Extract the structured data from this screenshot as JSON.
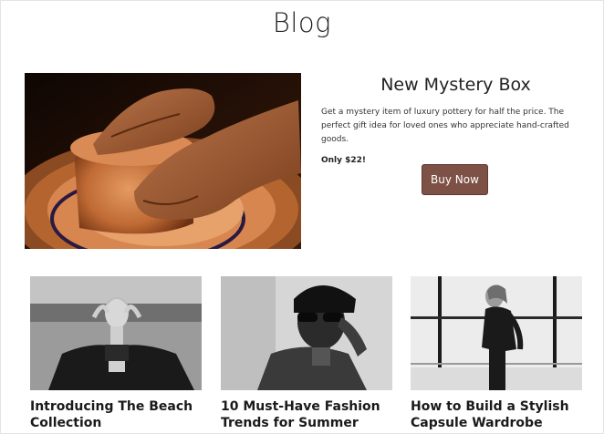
{
  "page": {
    "title": "Blog"
  },
  "promo": {
    "title": "New Mystery Box",
    "description": "Get a mystery item of luxury pottery for half the price. The perfect gift idea for loved ones who appreciate hand-crafted goods.",
    "price": "Only $22!",
    "button_label": "Buy Now",
    "image": "pottery-wheel-photo"
  },
  "posts": [
    {
      "title": "Introducing The Beach Collection",
      "image": "beach-model-photo"
    },
    {
      "title": "10 Must-Have Fashion Trends for Summer",
      "image": "man-sunglasses-photo"
    },
    {
      "title": "How to Build a Stylish Capsule Wardrobe",
      "image": "window-model-photo"
    }
  ],
  "colors": {
    "button": "#7d5145",
    "text": "#1a1a1a",
    "background": "#ffffff"
  }
}
